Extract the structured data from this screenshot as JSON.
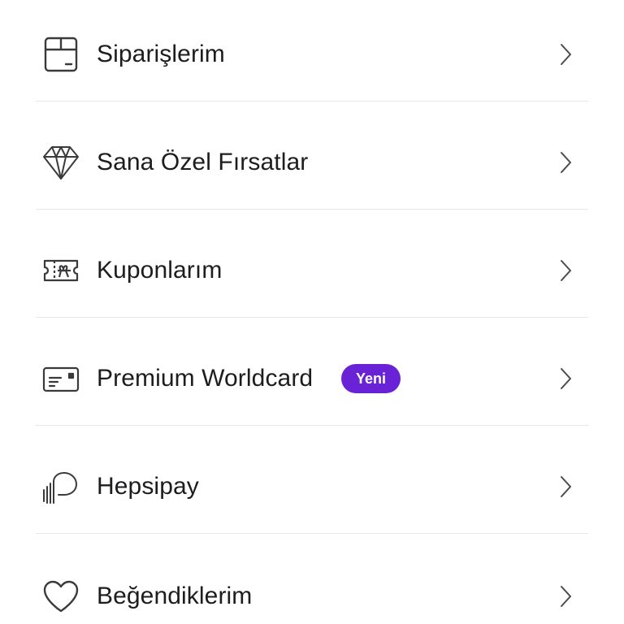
{
  "menu": {
    "items": [
      {
        "label": "Siparişlerim",
        "icon": "package-box-icon"
      },
      {
        "label": "Sana Özel Fırsatlar",
        "icon": "diamond-icon"
      },
      {
        "label": "Kuponlarım",
        "icon": "gift-coupon-icon"
      },
      {
        "label": "Premium Worldcard",
        "icon": "credit-card-icon",
        "badge": "Yeni"
      },
      {
        "label": "Hepsipay",
        "icon": "hepsipay-logo-icon"
      },
      {
        "label": "Beğendiklerim",
        "icon": "heart-icon"
      }
    ]
  },
  "colors": {
    "text": "#1d1d1f",
    "icon": "#3a3a3c",
    "badge_bg": "#6a22d6",
    "badge_text": "#ffffff",
    "divider": "#e8e8ea",
    "chevron": "#4a4a4e"
  }
}
